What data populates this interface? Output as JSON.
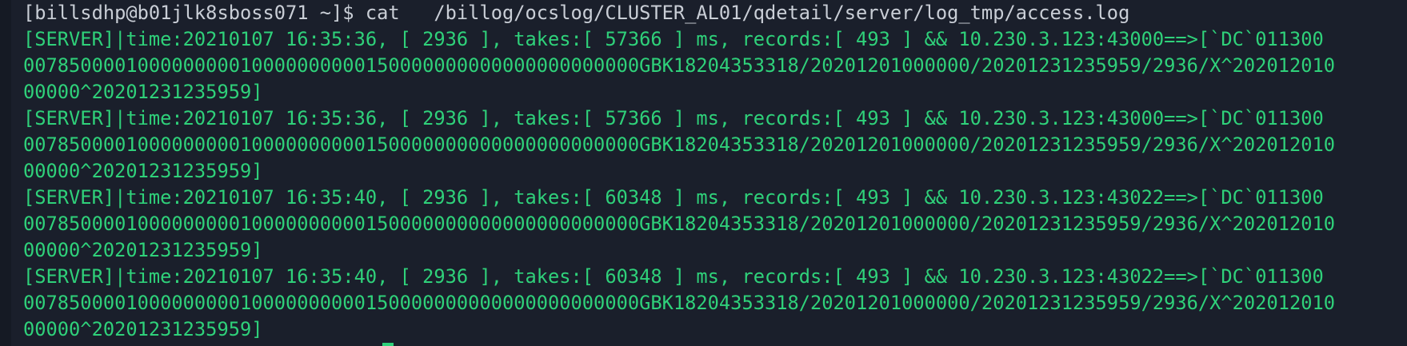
{
  "terminal": {
    "prompt_line": "[billsdhp@b01jlk8sboss071 ~]$ cat   /billog/ocslog/CLUSTER_AL01/qdetail/server/log_tmp/access.log",
    "lines": [
      "[SERVER]|time:20210107 16:35:36, [ 2936 ], takes:[ 57366 ] ms, records:[ 493 ] && 10.230.3.123:43000==>[`DC`011300",
      "007850000100000000010000000000150000000000000000000000GBK18204353318/20201201000000/20201231235959/2936/X^202012010",
      "00000^20201231235959]",
      "[SERVER]|time:20210107 16:35:36, [ 2936 ], takes:[ 57366 ] ms, records:[ 493 ] && 10.230.3.123:43000==>[`DC`011300",
      "007850000100000000010000000000150000000000000000000000GBK18204353318/20201201000000/20201231235959/2936/X^202012010",
      "00000^20201231235959]",
      "[SERVER]|time:20210107 16:35:40, [ 2936 ], takes:[ 60348 ] ms, records:[ 493 ] && 10.230.3.123:43022==>[`DC`011300",
      "007850000100000000010000000000150000000000000000000000GBK18204353318/20201201000000/20201231235959/2936/X^202012010",
      "00000^20201231235959]",
      "[SERVER]|time:20210107 16:35:40, [ 2936 ], takes:[ 60348 ] ms, records:[ 493 ] && 10.230.3.123:43022==>[`DC`011300",
      "007850000100000000010000000000150000000000000000000000GBK18204353318/20201201000000/20201231235959/2936/X^202012010",
      "00000^20201231235959]"
    ]
  },
  "colors": {
    "background": "#1a1f2b",
    "prompt_text": "#c9ced6",
    "log_text": "#2fd17a"
  }
}
